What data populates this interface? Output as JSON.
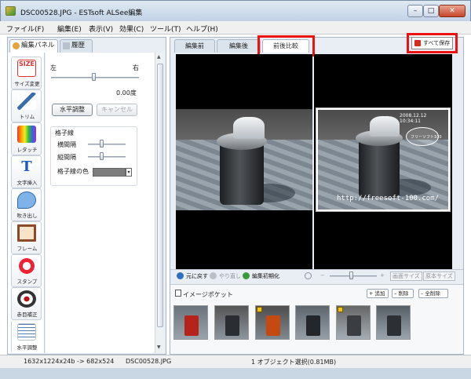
{
  "window": {
    "title": "DSC00528.JPG - ESTsoft ALSee編集",
    "controls": {
      "minimize": "–",
      "maximize": "□",
      "close": "✕"
    }
  },
  "menu": [
    "ファイル(F)",
    "編集(E)",
    "表示(V)",
    "効果(C)",
    "ツール(T)",
    "ヘルプ(H)"
  ],
  "left_tabs": [
    {
      "label": "編集パネル",
      "active": true
    },
    {
      "label": "履歴",
      "active": false
    }
  ],
  "tools": [
    {
      "label": "サイズ変更",
      "glyph_text": "SIZE",
      "icon": "size-icon"
    },
    {
      "label": "トリム",
      "icon": "scissors-icon"
    },
    {
      "label": "レタッチ",
      "icon": "color-retouch-icon"
    },
    {
      "label": "文字挿入",
      "glyph_text": "T",
      "icon": "text-icon"
    },
    {
      "label": "吹き出し",
      "icon": "speech-bubble-icon"
    },
    {
      "label": "フレーム",
      "icon": "frame-icon"
    },
    {
      "label": "スタンプ",
      "icon": "stamp-icon"
    },
    {
      "label": "赤目補正",
      "icon": "eye-icon"
    },
    {
      "label": "水平調整",
      "icon": "level-icon",
      "selected": true
    }
  ],
  "level_panel": {
    "left_label": "左",
    "right_label": "右",
    "angle": "0.00度",
    "apply_button": "水平調整",
    "cancel_button": "キャンセル",
    "grid_title": "格子線",
    "h_spacing": "横間隔",
    "v_spacing": "縦間隔",
    "grid_color": "格子線の色",
    "grid_color_value": "#7d7d7d"
  },
  "right_tabs": [
    {
      "label": "編集前",
      "active": false
    },
    {
      "label": "編集後",
      "active": false
    },
    {
      "label": "前後比較",
      "active": true
    }
  ],
  "save_all": "すべて保存",
  "highlight_color": "#ee1111",
  "photo_after": {
    "date_stamp": "2008.12.12 10:34:11",
    "bubble": "フリーソフト100",
    "url": "http://freesoft-100.com/"
  },
  "viewbar": {
    "undo": "元に戻す",
    "redo": "やり直し",
    "reset": "編集初期化",
    "fit": "画面サイズ",
    "original": "原本サイズ",
    "zoom_minus": "−",
    "zoom_plus": "+"
  },
  "pocket": {
    "title": "イメージポケット",
    "add": "追加",
    "remove": "削除",
    "remove_all": "全削除",
    "thumb_count": 6
  },
  "status": {
    "size": "1632x1224x24b -> 682x524",
    "file": "DSC00528.JPG",
    "selection": "1 オブジェクト選択(0.81MB)"
  }
}
